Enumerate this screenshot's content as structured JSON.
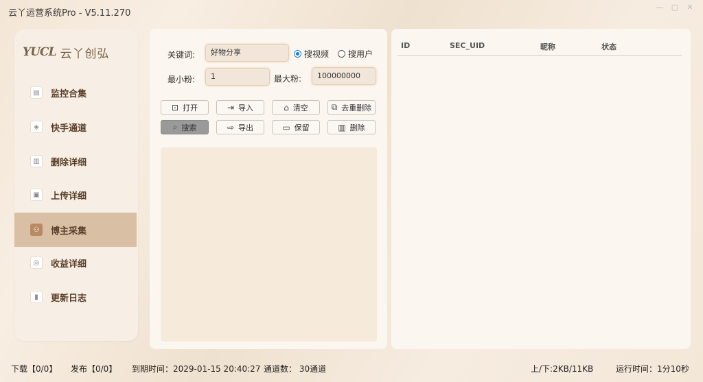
{
  "window": {
    "title": "云丫运营系统Pro - V5.11.270"
  },
  "logo": {
    "mark": "YUCL",
    "text": "云丫创弘"
  },
  "sidebar": {
    "items": [
      {
        "label": "监控合集",
        "icon": "monitor-icon",
        "glyph": "▤"
      },
      {
        "label": "快手通道",
        "icon": "channel-icon",
        "glyph": "◈"
      },
      {
        "label": "删除详细",
        "icon": "trash-icon",
        "glyph": "▥"
      },
      {
        "label": "上传详细",
        "icon": "upload-icon",
        "glyph": "▣"
      },
      {
        "label": "博主采集",
        "icon": "users-icon",
        "glyph": "⚇",
        "active": true
      },
      {
        "label": "收益详细",
        "icon": "income-icon",
        "glyph": "◎"
      },
      {
        "label": "更新日志",
        "icon": "log-icon",
        "glyph": "▮"
      }
    ]
  },
  "form": {
    "keyword_label": "关键词:",
    "keyword_value": "好物分享",
    "radio_video": "搜视频",
    "radio_user": "搜用户",
    "min_fans_label": "最小粉:",
    "min_fans_value": "1",
    "max_fans_label": "最大粉:",
    "max_fans_value": "100000000"
  },
  "buttons": {
    "open": "打开",
    "import": "导入",
    "clear": "清空",
    "dedupe": "去重删除",
    "search": "搜索",
    "export": "导出",
    "keep": "保留",
    "delete": "删除"
  },
  "table": {
    "columns": [
      "ID",
      "SEC_UID",
      "昵称",
      "状态"
    ]
  },
  "statusbar": {
    "download": "下载【0/0】",
    "publish": "发布【0/0】",
    "expire": "到期时间：2029-01-15 20:40:27",
    "channels": "通道数：  30通道",
    "traffic": "上/下:2KB/11KB",
    "runtime": "运行时间：1分10秒"
  },
  "colors": {
    "accent": "#d9bfa3",
    "radio": "#1e7bd6",
    "brand": "#7a6245"
  }
}
